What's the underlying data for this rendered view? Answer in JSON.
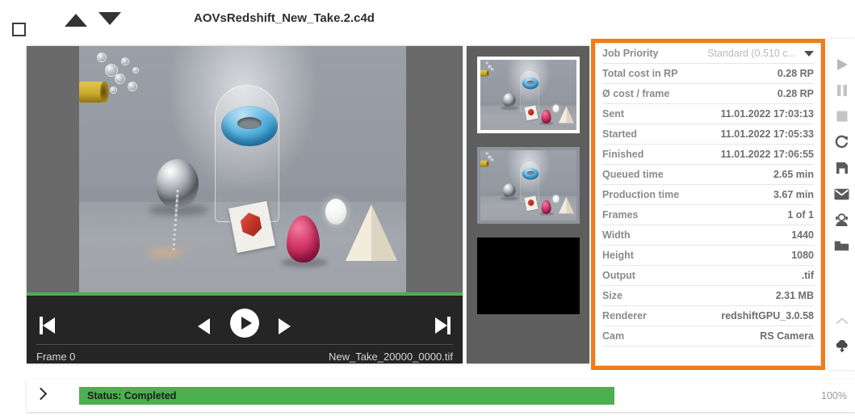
{
  "header": {
    "title": "AOVsRedshift_New_Take.2.c4d",
    "checkbox_name": "select-job-checkbox",
    "nav_up_label": "▲",
    "nav_down_label": "▼"
  },
  "player": {
    "frame_label": "Frame 0",
    "file_label": "New_Take_20000_0000.tif",
    "controls": {
      "jump_start": "Jump to first frame",
      "step_back": "Previous frame",
      "play": "Play",
      "step_forward": "Next frame",
      "jump_end": "Jump to last frame"
    }
  },
  "thumbnails": [
    {
      "name": "thumbnail-1",
      "selected": true,
      "kind": "render"
    },
    {
      "name": "thumbnail-2",
      "selected": false,
      "kind": "render"
    },
    {
      "name": "thumbnail-3",
      "selected": false,
      "kind": "black"
    }
  ],
  "details": {
    "rows": [
      {
        "key": "Job Priority",
        "value": "Standard (0.510 c...",
        "muted": true,
        "dropdown": true
      },
      {
        "key": "Total cost in RP",
        "value": "0.28 RP"
      },
      {
        "key": "Ø cost / frame",
        "value": "0.28 RP"
      },
      {
        "key": "Sent",
        "value": "11.01.2022 17:03:13"
      },
      {
        "key": "Started",
        "value": "11.01.2022 17:05:33"
      },
      {
        "key": "Finished",
        "value": "11.01.2022 17:06:55"
      },
      {
        "key": "Queued time",
        "value": "2.65 min"
      },
      {
        "key": "Production time",
        "value": "3.67 min"
      },
      {
        "key": "Frames",
        "value": "1 of 1"
      },
      {
        "key": "Width",
        "value": "1440"
      },
      {
        "key": "Height",
        "value": "1080"
      },
      {
        "key": "Output",
        "value": ".tif"
      },
      {
        "key": "Size",
        "value": "2.31 MB"
      },
      {
        "key": "Renderer",
        "value": "redshiftGPU_3.0.58"
      },
      {
        "key": "Cam",
        "value": "RS Camera"
      }
    ],
    "highlight_color": "#f07d1a"
  },
  "toolbar": {
    "items": [
      {
        "icon": "play-icon",
        "label": "Start",
        "disabled": true
      },
      {
        "icon": "pause-icon",
        "label": "Pause",
        "disabled": true
      },
      {
        "icon": "stop-icon",
        "label": "Stop",
        "disabled": true
      },
      {
        "icon": "restart-icon",
        "label": "Restart",
        "disabled": false
      },
      {
        "icon": "save-icon",
        "label": "Save",
        "disabled": false
      },
      {
        "icon": "mail-icon",
        "label": "Mail",
        "disabled": false
      },
      {
        "icon": "support-icon",
        "label": "Support",
        "disabled": false
      },
      {
        "icon": "folder-icon",
        "label": "Open folder",
        "disabled": false
      },
      {
        "icon": "chevron-up-icon",
        "label": "Collapse",
        "disabled": true
      },
      {
        "icon": "cloud-download-icon",
        "label": "Download",
        "disabled": false
      }
    ]
  },
  "status": {
    "text": "Status: Completed",
    "percent_label": "100%",
    "percent_value": 100,
    "bar_color": "#4caf50",
    "expander": "chevron-right"
  }
}
